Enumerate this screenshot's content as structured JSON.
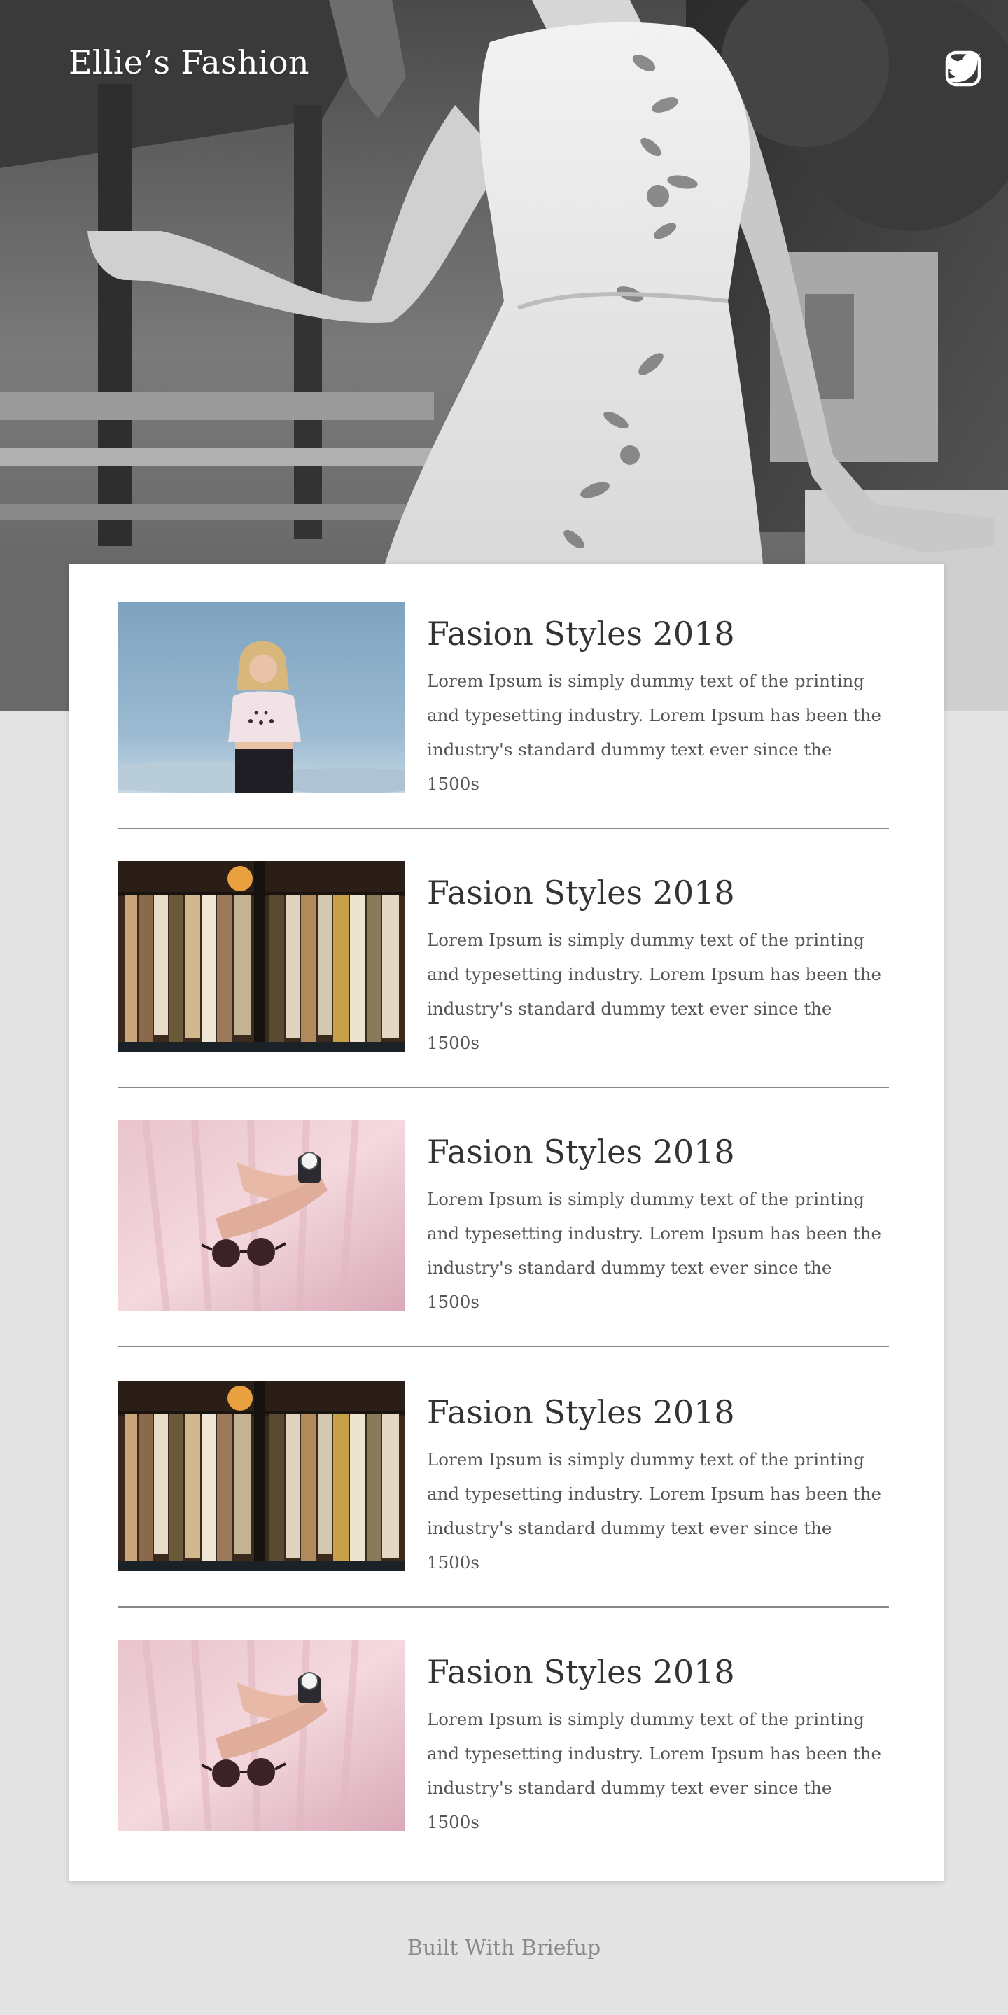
{
  "header": {
    "brand": "Ellie’s Fashion",
    "social_icons": [
      "instagram-icon",
      "twitter-icon"
    ]
  },
  "posts": [
    {
      "image": "woman-blonde-hair-photo",
      "title": "Fasion Styles 2018",
      "body": "Lorem Ipsum is simply dummy text of the printing and typesetting industry. Lorem Ipsum has been the industry's standard dummy text ever since the 1500s"
    },
    {
      "image": "clothing-racks-photo",
      "title": "Fasion Styles 2018",
      "body": "Lorem Ipsum is simply dummy text of the printing and typesetting industry. Lorem Ipsum has been the industry's standard dummy text ever since the 1500s"
    },
    {
      "image": "pink-skirt-sunglasses-photo",
      "title": "Fasion Styles 2018",
      "body": "Lorem Ipsum is simply dummy text of the printing and typesetting industry. Lorem Ipsum has been the industry's standard dummy text ever since the 1500s"
    },
    {
      "image": "clothing-racks-photo",
      "title": "Fasion Styles 2018",
      "body": "Lorem Ipsum is simply dummy text of the printing and typesetting industry. Lorem Ipsum has been the industry's standard dummy text ever since the 1500s"
    },
    {
      "image": "pink-skirt-sunglasses-photo",
      "title": "Fasion Styles 2018",
      "body": "Lorem Ipsum is simply dummy text of the printing and typesetting industry. Lorem Ipsum has been the industry's standard dummy text ever since the 1500s"
    }
  ],
  "footer": {
    "text": "Built With Briefup"
  },
  "colors": {
    "page_background": "#e4e4e4",
    "card_background": "#ffffff",
    "divider": "#888888",
    "title_text": "#333333",
    "body_text": "#555555",
    "footer_text": "#888888"
  }
}
